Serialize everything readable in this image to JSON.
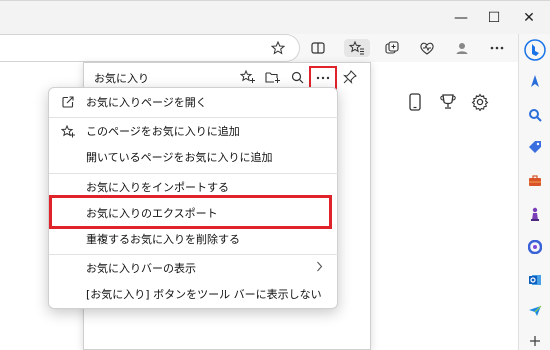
{
  "window": {
    "minimize_glyph": "—",
    "maximize_glyph": "☐",
    "close_glyph": "✕"
  },
  "favorites_panel": {
    "title": "お気に入り"
  },
  "menu": {
    "items": [
      {
        "label": "お気に入りページを開く",
        "icon": "open-external-icon"
      },
      {
        "label": "このページをお気に入りに追加",
        "icon": "add-favorite-icon"
      },
      {
        "label": "開いているページをお気に入りに追加",
        "icon": ""
      },
      {
        "label": "お気に入りをインポートする",
        "icon": ""
      },
      {
        "label": "お気に入りのエクスポート",
        "icon": ""
      },
      {
        "label": "重複するお気に入りを削除する",
        "icon": ""
      },
      {
        "label": "お気に入りバーの表示",
        "icon": "chevron-right-icon"
      },
      {
        "label": "[お気に入り] ボタンをツール バーに表示しない",
        "icon": ""
      }
    ]
  },
  "colors": {
    "highlight": "#e0222a",
    "bing": "#1a73e8"
  }
}
